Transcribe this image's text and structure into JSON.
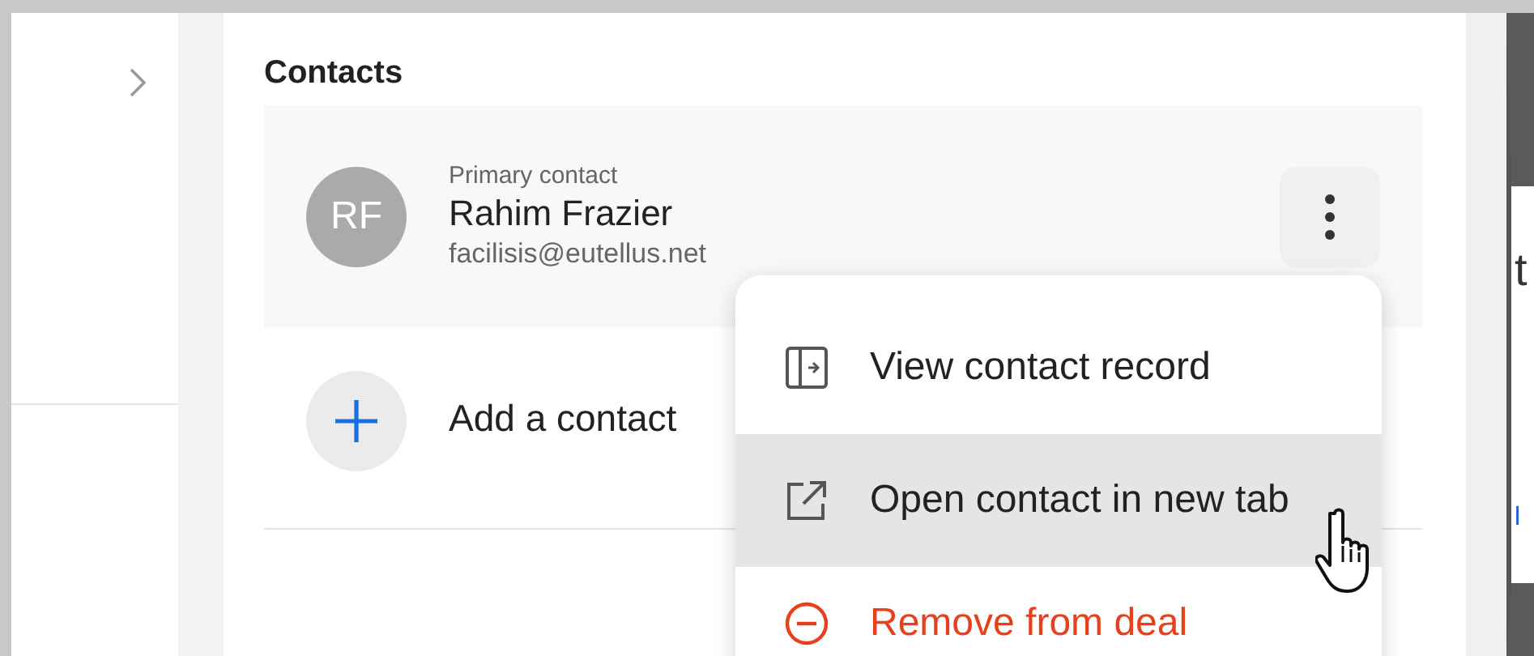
{
  "section": {
    "title": "Contacts"
  },
  "contact": {
    "initials": "RF",
    "role": "Primary contact",
    "name": "Rahim Frazier",
    "email": "facilisis@eutellus.net"
  },
  "add_contact": {
    "label": "Add a contact"
  },
  "menu": {
    "items": [
      {
        "label": "View contact record",
        "kind": "view",
        "selected": false
      },
      {
        "label": "Open contact in new tab",
        "kind": "open",
        "selected": true
      },
      {
        "label": "Remove from deal",
        "kind": "remove",
        "selected": false
      }
    ]
  },
  "right_edge": {
    "texts": [
      {
        "text": "t",
        "kind": "heading"
      },
      {
        "text": "l",
        "kind": "link"
      }
    ]
  }
}
